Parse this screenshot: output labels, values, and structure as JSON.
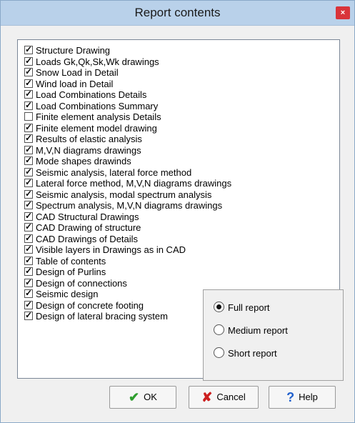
{
  "window": {
    "title": "Report contents",
    "close_glyph": "×"
  },
  "items": [
    {
      "label": "Structure Drawing",
      "checked": true
    },
    {
      "label": "Loads Gk,Qk,Sk,Wk drawings",
      "checked": true
    },
    {
      "label": "Snow Load in Detail",
      "checked": true
    },
    {
      "label": "Wind load in Detail",
      "checked": true
    },
    {
      "label": "Load Combinations Details",
      "checked": true
    },
    {
      "label": "Load Combinations Summary",
      "checked": true
    },
    {
      "label": "Finite element analysis Details",
      "checked": false
    },
    {
      "label": "Finite element model drawing",
      "checked": true
    },
    {
      "label": "Results of elastic analysis",
      "checked": true
    },
    {
      "label": "M,V,N diagrams drawings",
      "checked": true
    },
    {
      "label": "Mode shapes drawinds",
      "checked": true
    },
    {
      "label": "Seismic analysis, lateral force method",
      "checked": true
    },
    {
      "label": "Lateral force method, M,V,N diagrams drawings",
      "checked": true
    },
    {
      "label": "Seismic analysis, modal spectrum analysis",
      "checked": true
    },
    {
      "label": "Spectrum analysis, M,V,N diagrams drawings",
      "checked": true
    },
    {
      "label": "CAD Structural Drawings",
      "checked": true
    },
    {
      "label": "CAD Drawing of structure",
      "checked": true
    },
    {
      "label": "CAD Drawings of Details",
      "checked": true
    },
    {
      "label": "Visible layers in Drawings as in CAD",
      "checked": true
    },
    {
      "label": "Table of contents",
      "checked": true
    },
    {
      "label": "Design of Purlins",
      "checked": true
    },
    {
      "label": "Design of connections",
      "checked": true
    },
    {
      "label": "Seismic design",
      "checked": true
    },
    {
      "label": "Design of concrete footing",
      "checked": true
    },
    {
      "label": "Design of lateral bracing system",
      "checked": true
    }
  ],
  "report_type": {
    "options": [
      {
        "label": "Full report",
        "selected": true
      },
      {
        "label": "Medium report",
        "selected": false
      },
      {
        "label": "Short report",
        "selected": false
      }
    ]
  },
  "buttons": {
    "ok": {
      "label": "OK",
      "icon": "check-icon",
      "color": "#2e9e2e"
    },
    "cancel": {
      "label": "Cancel",
      "icon": "x-icon",
      "color": "#cc1f1f"
    },
    "help": {
      "label": "Help",
      "icon": "question-icon",
      "color": "#1f5fcc"
    }
  }
}
